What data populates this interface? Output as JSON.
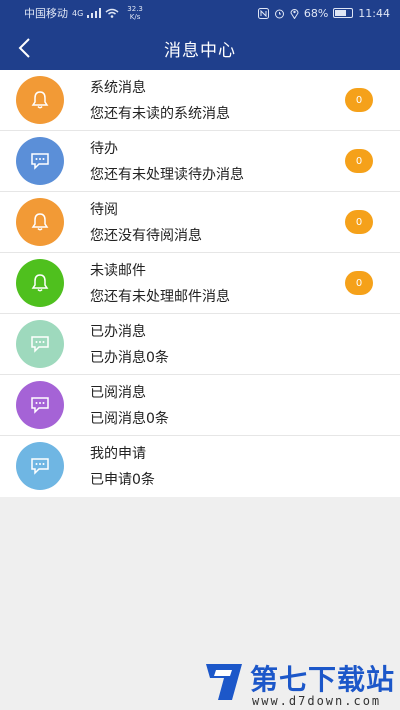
{
  "status_bar": {
    "carrier": "中国移动",
    "network": "4G",
    "speed_value": "32.3",
    "speed_unit": "K/s",
    "battery": "68%",
    "battery_level": 0.68,
    "time": "11:44"
  },
  "header": {
    "title": "消息中心",
    "back_icon": "chevron-left-icon"
  },
  "messages": [
    {
      "title": "系统消息",
      "subtitle": "您还有未读的系统消息",
      "icon": "bell-icon",
      "color": "#f29a36",
      "badge": "0"
    },
    {
      "title": "待办",
      "subtitle": "您还有未处理读待办消息",
      "icon": "chat-icon",
      "color": "#5b8fd8",
      "badge": "0"
    },
    {
      "title": "待阅",
      "subtitle": "您还没有待阅消息",
      "icon": "bell-icon",
      "color": "#f29a36",
      "badge": "0"
    },
    {
      "title": "未读邮件",
      "subtitle": "您还有未处理邮件消息",
      "icon": "bell-icon",
      "color": "#4fc01e",
      "badge": "0"
    },
    {
      "title": "已办消息",
      "subtitle": "已办消息0条",
      "icon": "chat-icon",
      "color": "#9ed9bd",
      "badge": ""
    },
    {
      "title": "已阅消息",
      "subtitle": "已阅消息0条",
      "icon": "chat-icon",
      "color": "#a563d6",
      "badge": ""
    },
    {
      "title": "我的申请",
      "subtitle": "已申请0条",
      "icon": "chat-icon",
      "color": "#6fb6e3",
      "badge": ""
    }
  ],
  "watermark": {
    "name": "第七下载站",
    "url": "www.d7down.com"
  }
}
